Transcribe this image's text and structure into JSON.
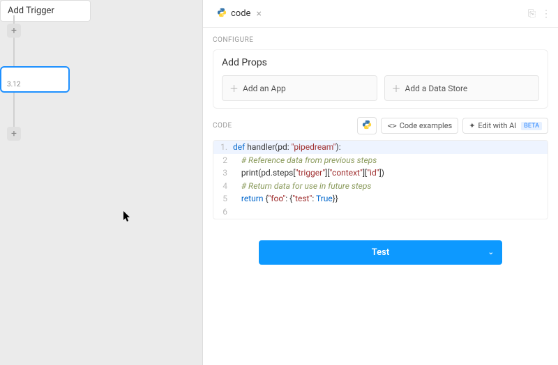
{
  "left": {
    "trigger_label": "Add Trigger",
    "step_label": "3.12"
  },
  "tab": {
    "title": "code"
  },
  "configure_label": "CONFIGURE",
  "props": {
    "title": "Add Props",
    "app_btn": "Add an App",
    "data_store_btn": "Add a Data Store"
  },
  "code": {
    "label": "CODE",
    "actions": {
      "examples": "Code examples",
      "edit_ai": "Edit with AI",
      "beta": "BETA"
    },
    "lines": [
      {
        "n": "1",
        "kw": "def",
        "fn": " handler(pd: ",
        "str": "\"pipedream\"",
        "rest": "):"
      },
      {
        "n": "2",
        "indent": "    ",
        "cm": "# Reference data from previous steps"
      },
      {
        "n": "3",
        "indent": "    ",
        "call": "print(pd.steps[",
        "s1": "\"trigger\"",
        "m": "][",
        "s2": "\"context\"",
        "m2": "][",
        "s3": "\"id\"",
        "end": "])"
      },
      {
        "n": "4",
        "indent": "    ",
        "cm": "# Return data for use in future steps"
      },
      {
        "n": "5",
        "indent": "    ",
        "kw": "return",
        "rest": " {",
        "s1": "\"foo\"",
        "m": ": {",
        "s2": "\"test\"",
        "m2": ": ",
        "bl": "True",
        "end": "}}"
      },
      {
        "n": "6"
      }
    ]
  },
  "test_label": "Test"
}
